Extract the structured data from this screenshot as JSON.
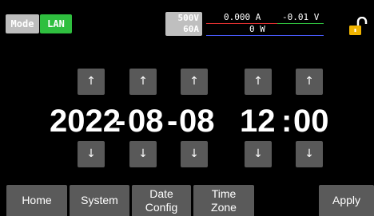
{
  "status": {
    "mode_label": "Mode",
    "interface_label": "LAN",
    "voltage_limit": "500V",
    "current_limit": "60A",
    "measured_current": "0.000 A",
    "measured_voltage": "-0.01 V",
    "measured_power": "0 W",
    "lock_state": "unlocked-lock-icon"
  },
  "datetime": {
    "year": "2022",
    "sep1": "-",
    "month": "08",
    "sep2": "-",
    "day": "08",
    "hour": "12",
    "sep3": ":",
    "minute": "00"
  },
  "arrows": {
    "up": "↑",
    "down": "↓"
  },
  "nav": {
    "home": "Home",
    "system": "System",
    "date_config_line1": "Date",
    "date_config_line2": "Config",
    "time_zone_line1": "Time",
    "time_zone_line2": "Zone",
    "apply": "Apply"
  },
  "colors": {
    "background": "#000000",
    "lan_badge": "#2fbf3f",
    "mode_badge": "#bdbdbd",
    "button": "#5a5a5a",
    "current_line": "#e03030",
    "voltage_line": "#2fbf3f",
    "lock": "#f0b400"
  }
}
